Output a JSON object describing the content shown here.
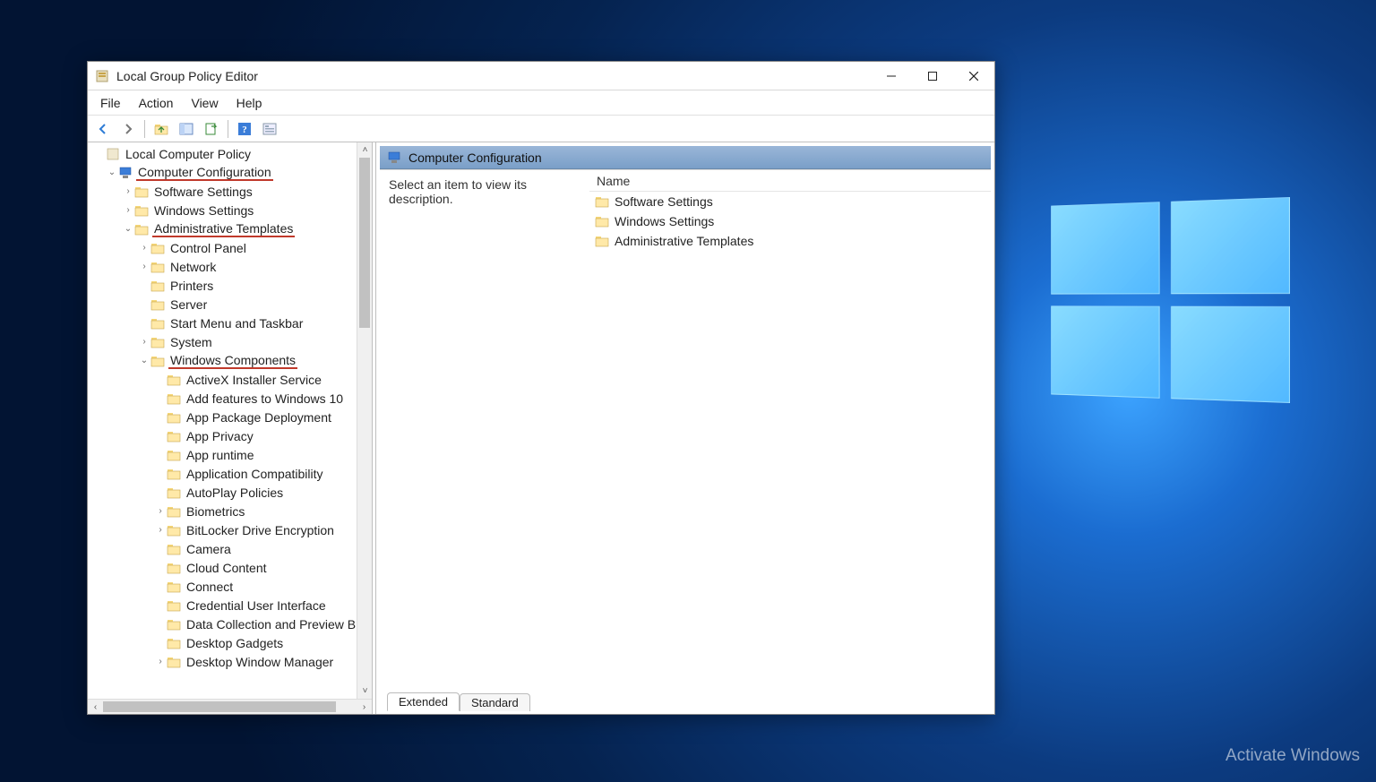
{
  "window": {
    "title": "Local Group Policy Editor"
  },
  "menu": [
    "File",
    "Action",
    "View",
    "Help"
  ],
  "tree": {
    "root": "Local Computer Policy",
    "computer_config": "Computer Configuration",
    "software_settings": "Software Settings",
    "windows_settings": "Windows Settings",
    "admin_templates": "Administrative Templates",
    "control_panel": "Control Panel",
    "network": "Network",
    "printers": "Printers",
    "server": "Server",
    "start_menu": "Start Menu and Taskbar",
    "system": "System",
    "win_components": "Windows Components",
    "wc": [
      "ActiveX Installer Service",
      "Add features to Windows 10",
      "App Package Deployment",
      "App Privacy",
      "App runtime",
      "Application Compatibility",
      "AutoPlay Policies",
      "Biometrics",
      "BitLocker Drive Encryption",
      "Camera",
      "Cloud Content",
      "Connect",
      "Credential User Interface",
      "Data Collection and Preview B",
      "Desktop Gadgets",
      "Desktop Window Manager"
    ],
    "wc_expanders": [
      "",
      "",
      "",
      "",
      "",
      "",
      "",
      ">",
      ">",
      "",
      "",
      "",
      "",
      "",
      "",
      ">"
    ]
  },
  "right": {
    "heading": "Computer Configuration",
    "desc": "Select an item to view its description.",
    "column": "Name",
    "items": [
      "Software Settings",
      "Windows Settings",
      "Administrative Templates"
    ]
  },
  "tabs": {
    "extended": "Extended",
    "standard": "Standard"
  },
  "watermark": "Activate Windows"
}
